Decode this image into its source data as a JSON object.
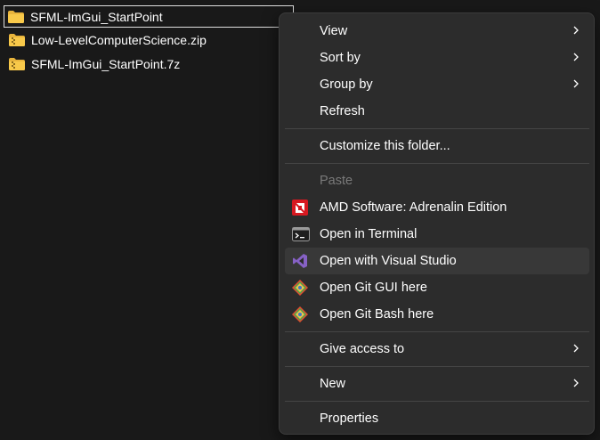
{
  "files": [
    {
      "name": "SFML-ImGui_StartPoint",
      "icon": "folder-icon"
    },
    {
      "name": "Low-LevelComputerScience.zip",
      "icon": "zip-folder-icon"
    },
    {
      "name": "SFML-ImGui_StartPoint.7z",
      "icon": "zip-folder-icon"
    }
  ],
  "menu": {
    "view": "View",
    "sort_by": "Sort by",
    "group_by": "Group by",
    "refresh": "Refresh",
    "customize": "Customize this folder...",
    "paste": "Paste",
    "amd": "AMD Software: Adrenalin Edition",
    "terminal": "Open in Terminal",
    "visual_studio": "Open with Visual Studio",
    "git_gui": "Open Git GUI here",
    "git_bash": "Open Git Bash here",
    "give_access": "Give access to",
    "new": "New",
    "properties": "Properties"
  },
  "colors": {
    "background": "#191919",
    "menu_bg": "#2c2c2c",
    "hover": "#383838",
    "amd_red": "#d71921",
    "vs_purple": "#8661c5",
    "folder_yellow": "#f8c94a"
  }
}
